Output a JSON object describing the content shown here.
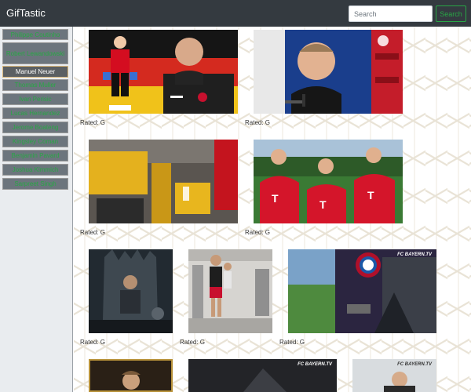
{
  "app": {
    "brand": "GifTastic"
  },
  "search": {
    "placeholder": "Search",
    "button_label": "Search"
  },
  "sidebar": {
    "items": [
      {
        "label": "Philippe Coutinho",
        "active": false
      },
      {
        "label": "Robert Lewandowski",
        "active": false
      },
      {
        "label": "Manuel Neuer",
        "active": true
      },
      {
        "label": "Thomas Muller",
        "active": false
      },
      {
        "label": "Ivan Perisic",
        "active": false
      },
      {
        "label": "Lucas Hernandez",
        "active": false
      },
      {
        "label": "Jerome Boateng",
        "active": false
      },
      {
        "label": "Kingsley Coman",
        "active": false
      },
      {
        "label": "Benjamin Pavard",
        "active": false
      },
      {
        "label": "Joshua Kimmich",
        "active": false
      },
      {
        "label": "Sarpreet Singh",
        "active": false
      }
    ]
  },
  "gifs": [
    {
      "rating": "Rated: G"
    },
    {
      "rating": "Rated: G"
    },
    {
      "rating": "Rated: G"
    },
    {
      "rating": "Rated: G"
    },
    {
      "rating": "Rated: G"
    },
    {
      "rating": "Rated: G"
    },
    {
      "rating": "Rated: G"
    }
  ],
  "overlay_text": {
    "fcb_tv": "FC BAYERN.TV",
    "fcb_tv_2": "FC BAYERN.TV",
    "fcb_tv_3": "FC BAYERN.TV",
    "fcb_crest": "FC BAYERN"
  },
  "colors": {
    "navbar": "#343a40",
    "sidebar_bg": "#e9ecef",
    "button_text": "#28a745",
    "button_bg": "#6c757d",
    "active_border": "#d9b77a"
  }
}
